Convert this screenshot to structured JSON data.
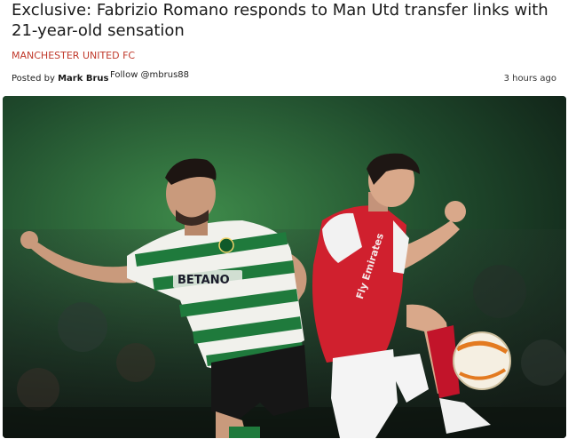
{
  "article": {
    "headline": "Exclusive: Fabrizio Romano responds to Man Utd transfer links with 21-year-old sensation",
    "category": "MANCHESTER UNITED FC",
    "posted_by_prefix": "Posted by",
    "author": "Mark Brus",
    "follow": "Follow @mbrus88",
    "timestamp": "3 hours ago"
  },
  "hero_image": {
    "shirt_sponsor_left": "BETANO",
    "shirt_sponsor_right": "Fly Emirates",
    "colors": {
      "pitch_green": "#2d6b3a",
      "sporting_green": "#1f7a3c",
      "arsenal_red": "#d0202e"
    }
  }
}
